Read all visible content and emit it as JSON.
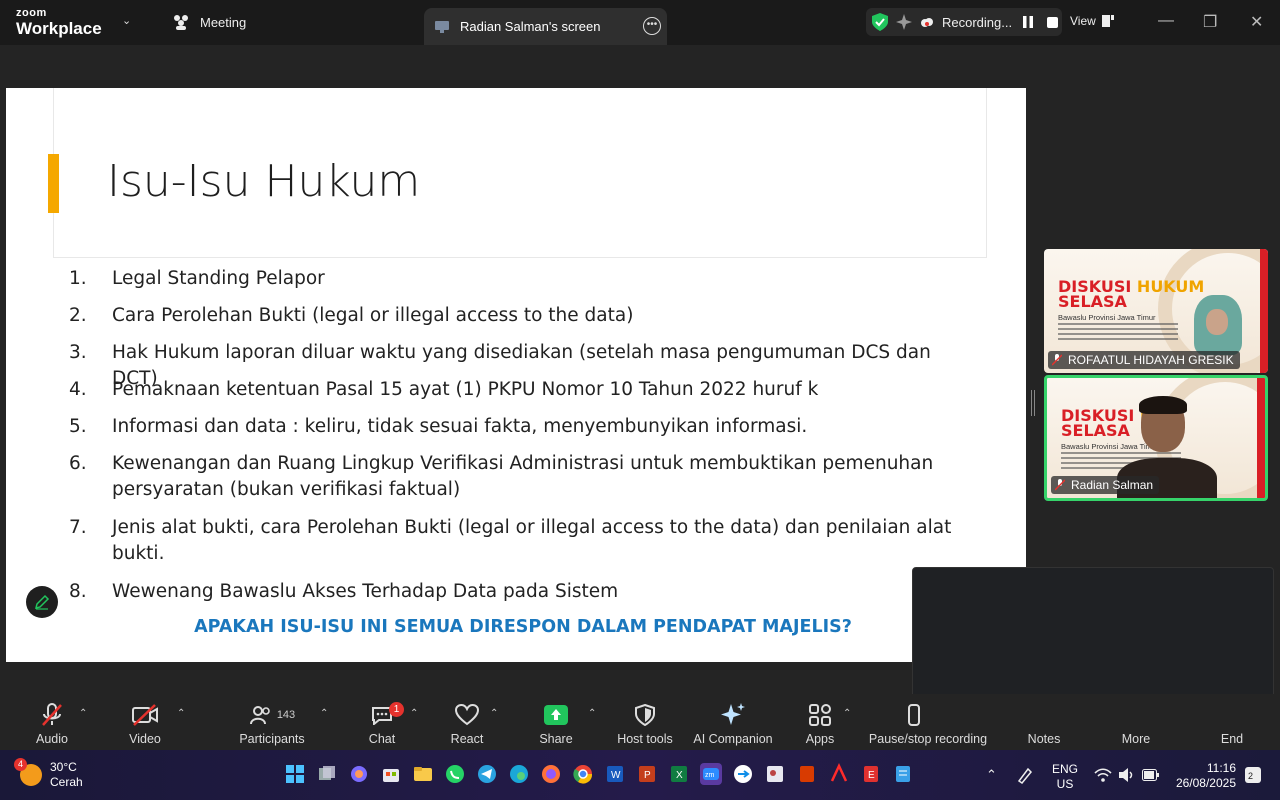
{
  "topbar": {
    "logo_line1": "zoom",
    "logo_line2": "Workplace",
    "meeting_label": "Meeting",
    "tab_label": "Radian Salman's screen",
    "recording_label": "Recording...",
    "view_label": "View"
  },
  "slide": {
    "title": "Isu-Isu Hukum",
    "items": [
      {
        "num": "1.",
        "text": "Legal Standing Pelapor"
      },
      {
        "num": "2.",
        "text": "Cara Perolehan Bukti (legal or illegal access to the data)"
      },
      {
        "num": "3.",
        "text": "Hak Hukum laporan diluar waktu yang disediakan (setelah masa pengumuman DCS dan DCT)"
      },
      {
        "num": "4.",
        "text": "Pemaknaan ketentuan Pasal 15 ayat (1) PKPU Nomor 10 Tahun 2022 huruf k"
      },
      {
        "num": "5.",
        "text": "Informasi dan data : keliru, tidak sesuai fakta, menyembunyikan informasi."
      },
      {
        "num": "6.",
        "text": "Kewenangan dan Ruang Lingkup Verifikasi Administrasi untuk membuktikan pemenuhan persyaratan  (bukan verifikasi faktual)"
      },
      {
        "num": "7.",
        "text": "Jenis alat bukti, cara Perolehan Bukti (legal or illegal access to the data) dan penilaian alat bukti."
      },
      {
        "num": "8.",
        "text": "Wewenang Bawaslu Akses Terhadap Data pada Sistem"
      }
    ],
    "question": "APAKAH ISU-ISU INI SEMUA DIRESPON DALAM PENDAPAT MAJELIS?"
  },
  "tiles": [
    {
      "name": "ROFAATUL HIDAYAH GRESIK",
      "heading1": "DISKUSI",
      "heading2": "HUKUM",
      "heading3": "SELASA",
      "sub": "Bawaslu Provinsi Jawa Timur"
    },
    {
      "name": "Radian Salman",
      "heading1": "DISKUSI",
      "heading2": "H",
      "heading3": "SELASA",
      "sub": "Bawaslu Provinsi Jawa Timur"
    }
  ],
  "toolbar": {
    "audio": "Audio",
    "video": "Video",
    "participants": "Participants",
    "participants_count": "143",
    "chat": "Chat",
    "chat_badge": "1",
    "react": "React",
    "share": "Share",
    "host_tools": "Host tools",
    "ai_companion": "AI Companion",
    "apps": "Apps",
    "pause_stop": "Pause/stop recording",
    "notes": "Notes",
    "more": "More",
    "end": "End"
  },
  "taskbar": {
    "weather_badge": "4",
    "temperature": "30°C",
    "condition": "Cerah",
    "lang1": "ENG",
    "lang2": "US",
    "time": "11:16",
    "date": "26/08/2025"
  },
  "colors": {
    "accent_orange": "#f5a800",
    "question_blue": "#1a77bd",
    "share_green": "#21c55d",
    "speaker_border": "#36d36a",
    "badge_red": "#e5322d"
  }
}
